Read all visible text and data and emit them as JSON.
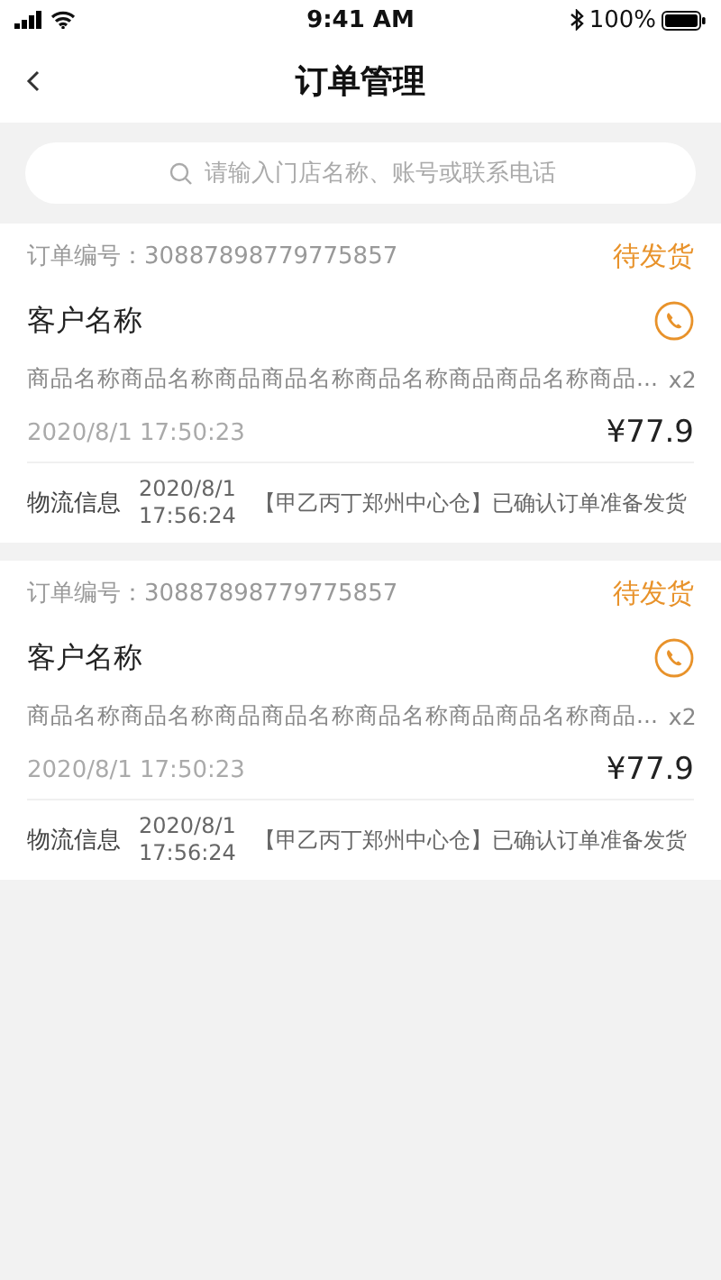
{
  "status_bar": {
    "time": "9:41 AM",
    "battery": "100%"
  },
  "nav": {
    "title": "订单管理"
  },
  "search": {
    "placeholder": "请输入门店名称、账号或联系电话"
  },
  "orders": [
    {
      "order_label": "订单编号：",
      "order_no": "30887898779775857",
      "status": "待发货",
      "customer": "客户名称",
      "goods": "商品名称商品名称商品商品名称商品名称商品商品名称商品...",
      "quantity": "x2",
      "time": "2020/8/1 17:50:23",
      "price": "¥77.9",
      "logistics_label": "物流信息",
      "logistics_date": "2020/8/1",
      "logistics_time": "17:56:24",
      "logistics_text": "【甲乙丙丁郑州中心仓】已确认订单准备发货"
    },
    {
      "order_label": "订单编号：",
      "order_no": "30887898779775857",
      "status": "待发货",
      "customer": "客户名称",
      "goods": "商品名称商品名称商品商品名称商品名称商品商品名称商品...",
      "quantity": "x2",
      "time": "2020/8/1 17:50:23",
      "price": "¥77.9",
      "logistics_label": "物流信息",
      "logistics_date": "2020/8/1",
      "logistics_time": "17:56:24",
      "logistics_text": "【甲乙丙丁郑州中心仓】已确认订单准备发货"
    }
  ]
}
